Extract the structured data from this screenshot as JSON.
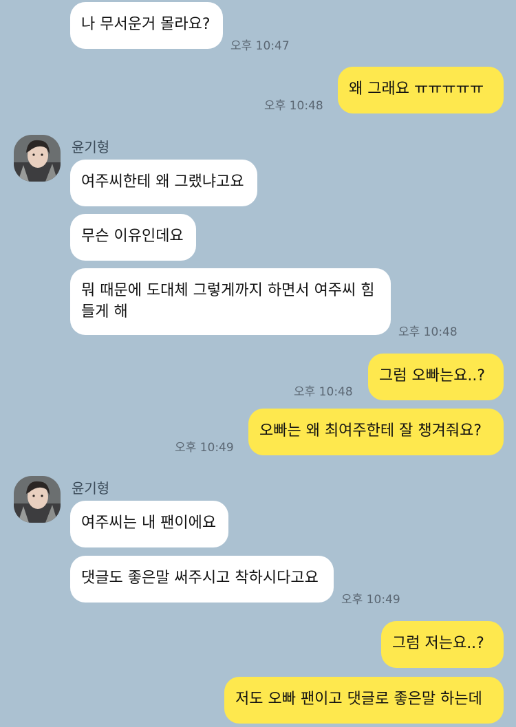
{
  "contact": {
    "name": "윤기형"
  },
  "messages": [
    {
      "side": "in",
      "text": "나 무서운거 몰라요?",
      "time": "오후 10:47"
    },
    {
      "side": "out",
      "text": "왜 그래요 ㅠㅠㅠㅠㅠ",
      "time": "오후 10:48"
    },
    {
      "side": "in",
      "text": "여주씨한테 왜 그랬냐고요"
    },
    {
      "side": "in",
      "text": "무슨 이유인데요"
    },
    {
      "side": "in",
      "text": "뭐 때문에 도대체 그렇게까지 하면서 여주씨 힘들게 해",
      "time": "오후 10:48"
    },
    {
      "side": "out",
      "text": "그럼 오빠는요..?",
      "time": "오후 10:48"
    },
    {
      "side": "out",
      "text": "오빠는 왜 최여주한테 잘 챙겨줘요?",
      "time": "오후 10:49"
    },
    {
      "side": "in",
      "text": "여주씨는 내 팬이에요"
    },
    {
      "side": "in",
      "text": "댓글도 좋은말 써주시고 착하시다고요",
      "time": "오후 10:49"
    },
    {
      "side": "out",
      "text": "그럼 저는요..?"
    },
    {
      "side": "out",
      "text": "저도 오빠 팬이고 댓글로 좋은말 하는데"
    }
  ],
  "colors": {
    "background": "#abc1d1",
    "incoming_bubble": "#ffffff",
    "outgoing_bubble": "#fee84e"
  }
}
